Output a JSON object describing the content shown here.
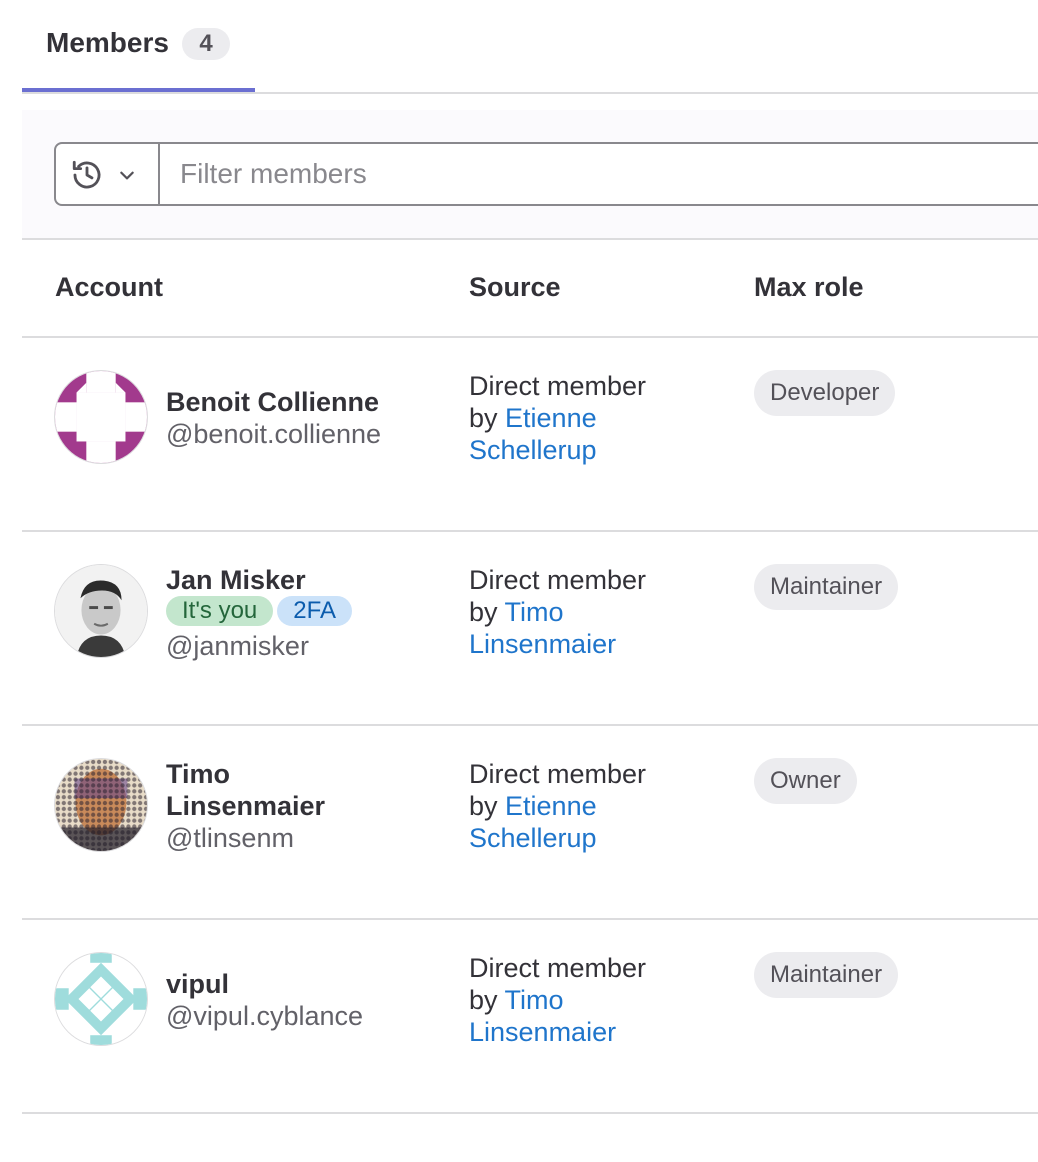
{
  "tabs": {
    "members_label": "Members",
    "members_count": "4"
  },
  "filter": {
    "placeholder": "Filter members",
    "history_icon": "history-icon",
    "dropdown_icon": "chevron-down-icon"
  },
  "table": {
    "headers": {
      "account": "Account",
      "source": "Source",
      "max_role": "Max role"
    },
    "rows": [
      {
        "name_line1": "Benoit Collienne",
        "name_line2": "",
        "username": "@benoit.collienne",
        "source_prefix": "Direct member",
        "source_by": "by ",
        "source_link": "Etienne Schellerup",
        "role": "Developer",
        "avatar": "identicon-magenta"
      },
      {
        "name_line1": "Jan Misker",
        "name_line2": "",
        "badge_you": "It's you",
        "badge_2fa": "2FA",
        "username": "@janmisker",
        "source_prefix": "Direct member",
        "source_by": "by ",
        "source_link": "Timo Linsenmaier",
        "role": "Maintainer",
        "avatar": "photo"
      },
      {
        "name_line1": "Timo",
        "name_line2": "Linsenmaier",
        "username": "@tlinsenm",
        "source_prefix": "Direct member",
        "source_by": "by ",
        "source_link": "Etienne Schellerup",
        "role": "Owner",
        "avatar": "photo-halftone"
      },
      {
        "name_line1": "vipul",
        "name_line2": "",
        "username": "@vipul.cyblance",
        "source_prefix": "Direct member",
        "source_by": "by ",
        "source_link": "Timo Linsenmaier",
        "role": "Maintainer",
        "avatar": "identicon-teal"
      }
    ]
  },
  "colors": {
    "tab_underline": "#6b6fd1",
    "link": "#1f75cb",
    "badge_you_bg": "#c3e6cd",
    "badge_2fa_bg": "#cbe2f9"
  }
}
